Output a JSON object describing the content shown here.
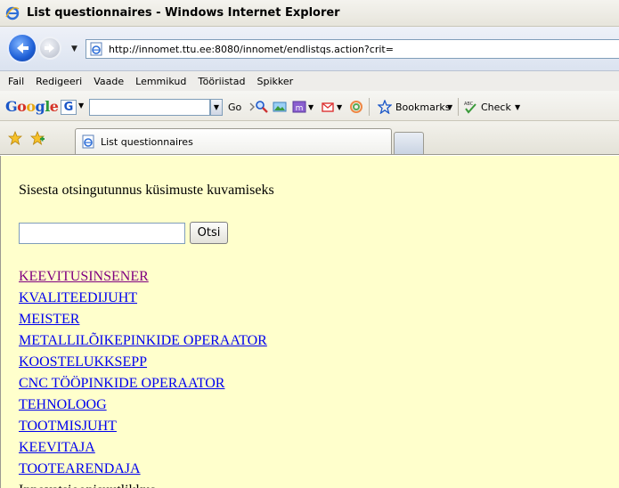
{
  "window": {
    "title": "List questionnaires - Windows Internet Explorer"
  },
  "address_bar": {
    "url": "http://innomet.ttu.ee:8080/innomet/endlistqs.action?crit="
  },
  "menu": [
    "Fail",
    "Redigeeri",
    "Vaade",
    "Lemmikud",
    "Tööriistad",
    "Spikker"
  ],
  "google_toolbar": {
    "logo": "Google",
    "go_label": "Go",
    "bookmarks_label": "Bookmarks",
    "check_label": "Check"
  },
  "tab": {
    "label": "List questionnaires"
  },
  "content": {
    "prompt": "Sisesta otsingutunnus küsimuste kuvamiseks",
    "search_value": "",
    "search_button": "Otsi",
    "links": [
      {
        "label": "KEEVITUSINSENER",
        "visited": true
      },
      {
        "label": "KVALITEEDIJUHT",
        "visited": false
      },
      {
        "label": "MEISTER",
        "visited": false
      },
      {
        "label": "METALLILÕIKEPINKIDE OPERAATOR",
        "visited": false
      },
      {
        "label": "KOOSTELUKKSEPP",
        "visited": false
      },
      {
        "label": "CNC TÖÖPINKIDE OPERAATOR",
        "visited": false
      },
      {
        "label": "TEHNOLOOG",
        "visited": false
      },
      {
        "label": "TOOTMISJUHT",
        "visited": false
      },
      {
        "label": "KEEVITAJA",
        "visited": false
      },
      {
        "label": "TOOTEARENDAJA",
        "visited": false
      }
    ],
    "trailing_text": "Innovatsioonisuutlikkus"
  },
  "colors": {
    "page_background": "#ffffcc",
    "link": "#0000ee",
    "visited_link": "#800080"
  }
}
